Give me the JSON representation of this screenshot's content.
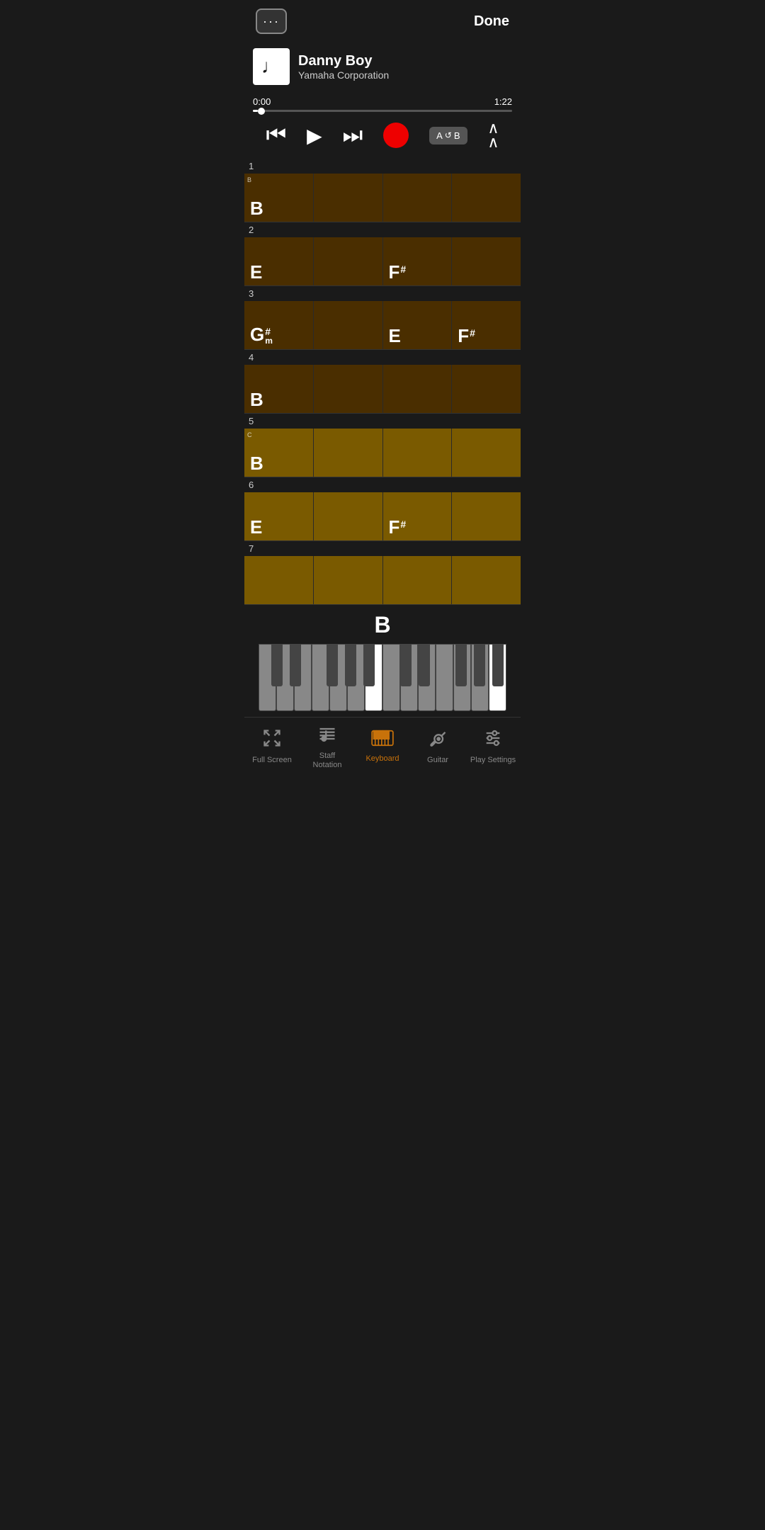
{
  "header": {
    "menu_label": "···",
    "done_label": "Done"
  },
  "song": {
    "title": "Danny Boy",
    "artist": "Yamaha Corporation",
    "current_time": "0:00",
    "total_time": "1:22",
    "progress_pct": 2
  },
  "transport": {
    "rewind_label": "rewind",
    "play_label": "play",
    "forward_label": "fast-forward",
    "record_label": "record",
    "ab_label": "A↺B",
    "up_label": "scroll-up"
  },
  "measures": [
    {
      "num": "1",
      "page_marker": "B",
      "cells": [
        {
          "chord": "B",
          "sup": "",
          "sub": "",
          "type": "dark"
        },
        {
          "chord": "",
          "sup": "",
          "sub": "",
          "type": "dark"
        },
        {
          "chord": "",
          "sup": "",
          "sub": "",
          "type": "dark"
        },
        {
          "chord": "",
          "sup": "",
          "sub": "",
          "type": "dark"
        }
      ]
    },
    {
      "num": "2",
      "page_marker": "",
      "cells": [
        {
          "chord": "E",
          "sup": "",
          "sub": "",
          "type": "dark"
        },
        {
          "chord": "",
          "sup": "",
          "sub": "",
          "type": "dark"
        },
        {
          "chord": "F",
          "sup": "#",
          "sub": "",
          "type": "dark"
        },
        {
          "chord": "",
          "sup": "",
          "sub": "",
          "type": "dark"
        }
      ]
    },
    {
      "num": "3",
      "page_marker": "",
      "cells": [
        {
          "chord": "G",
          "sup": "#",
          "sub": "m",
          "type": "dark"
        },
        {
          "chord": "",
          "sup": "",
          "sub": "",
          "type": "dark"
        },
        {
          "chord": "E",
          "sup": "",
          "sub": "",
          "type": "dark"
        },
        {
          "chord": "F",
          "sup": "#",
          "sub": "",
          "type": "dark"
        }
      ]
    },
    {
      "num": "4",
      "page_marker": "",
      "cells": [
        {
          "chord": "B",
          "sup": "",
          "sub": "",
          "type": "dark"
        },
        {
          "chord": "",
          "sup": "",
          "sub": "",
          "type": "dark"
        },
        {
          "chord": "",
          "sup": "",
          "sub": "",
          "type": "dark"
        },
        {
          "chord": "",
          "sup": "",
          "sub": "",
          "type": "dark"
        }
      ]
    },
    {
      "num": "5",
      "page_marker": "C",
      "cells": [
        {
          "chord": "B",
          "sup": "",
          "sub": "",
          "type": "med"
        },
        {
          "chord": "",
          "sup": "",
          "sub": "",
          "type": "med"
        },
        {
          "chord": "",
          "sup": "",
          "sub": "",
          "type": "med"
        },
        {
          "chord": "",
          "sup": "",
          "sub": "",
          "type": "med"
        }
      ]
    },
    {
      "num": "6",
      "page_marker": "",
      "cells": [
        {
          "chord": "E",
          "sup": "",
          "sub": "",
          "type": "med"
        },
        {
          "chord": "",
          "sup": "",
          "sub": "",
          "type": "med"
        },
        {
          "chord": "F",
          "sup": "#",
          "sub": "",
          "type": "med"
        },
        {
          "chord": "",
          "sup": "",
          "sub": "",
          "type": "med"
        }
      ]
    },
    {
      "num": "7",
      "page_marker": "",
      "cells": [
        {
          "chord": "",
          "sup": "",
          "sub": "",
          "type": "med"
        },
        {
          "chord": "",
          "sup": "",
          "sub": "",
          "type": "med"
        },
        {
          "chord": "",
          "sup": "",
          "sub": "",
          "type": "med"
        },
        {
          "chord": "",
          "sup": "",
          "sub": "",
          "type": "med"
        }
      ]
    }
  ],
  "keyboard": {
    "current_chord": "B"
  },
  "tabs": [
    {
      "id": "fullscreen",
      "label": "Full Screen",
      "active": false
    },
    {
      "id": "staff",
      "label": "Staff\nNotation",
      "active": false
    },
    {
      "id": "keyboard",
      "label": "Keyboard",
      "active": true
    },
    {
      "id": "guitar",
      "label": "Guitar",
      "active": false
    },
    {
      "id": "playsettings",
      "label": "Play Settings",
      "active": false
    }
  ]
}
